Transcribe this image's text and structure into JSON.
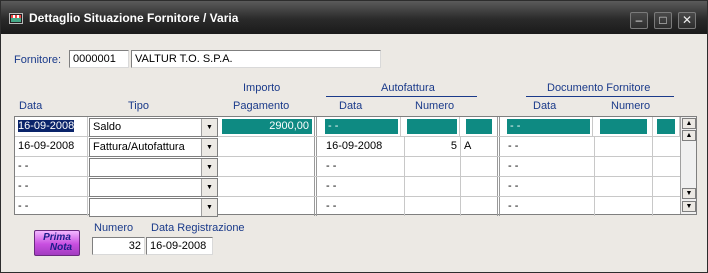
{
  "window": {
    "title": "Dettaglio Situazione Fornitore / Varia"
  },
  "fornitore": {
    "label": "Fornitore:",
    "code": "0000001",
    "name": "VALTUR T.O. S.P.A."
  },
  "headers": {
    "importo": "Importo",
    "pagamento": "Pagamento",
    "autofattura": "Autofattura",
    "documento_fornitore": "Documento Fornitore",
    "data": "Data",
    "tipo": "Tipo",
    "af_data": "Data",
    "af_numero": "Numero",
    "df_data": "Data",
    "df_numero": "Numero"
  },
  "rows": [
    {
      "data": "16-09-2008",
      "tipo": "Saldo",
      "importo": "2900,00",
      "af_data": "- -",
      "af_numero": "",
      "af_suffix": "",
      "df_data": "- -"
    },
    {
      "data": "16-09-2008",
      "tipo": "Fattura/Autofattura",
      "importo": "",
      "af_data": "16-09-2008",
      "af_numero": "5",
      "af_suffix": "A",
      "df_data": "- -"
    },
    {
      "data": "- -",
      "tipo": "",
      "importo": "",
      "af_data": "- -",
      "af_numero": "",
      "af_suffix": "",
      "df_data": "- -"
    },
    {
      "data": "- -",
      "tipo": "",
      "importo": "",
      "af_data": "- -",
      "af_numero": "",
      "af_suffix": "",
      "df_data": "- -"
    },
    {
      "data": "- -",
      "tipo": "",
      "importo": "",
      "af_data": "- -",
      "af_numero": "",
      "af_suffix": "",
      "df_data": "- -"
    }
  ],
  "footer": {
    "prima_nota_line1": "Prima",
    "prima_nota_line2": "Nota",
    "numero_label": "Numero",
    "data_registrazione_label": "Data Registrazione",
    "numero": "32",
    "data_registrazione": "16-09-2008"
  },
  "icons": {
    "app": "app-window-icon",
    "minimize": "minimize-icon",
    "maximize": "maximize-icon",
    "close": "close-icon",
    "dropdown": "chevron-down-icon",
    "scroll_up": "scroll-up-icon",
    "scroll_down": "scroll-down-icon"
  },
  "colors": {
    "titlebar": "#2a2a2a",
    "label_text": "#1a3a8a",
    "selection_teal": "#0e8a82",
    "selected_cell": "#0a246a"
  }
}
